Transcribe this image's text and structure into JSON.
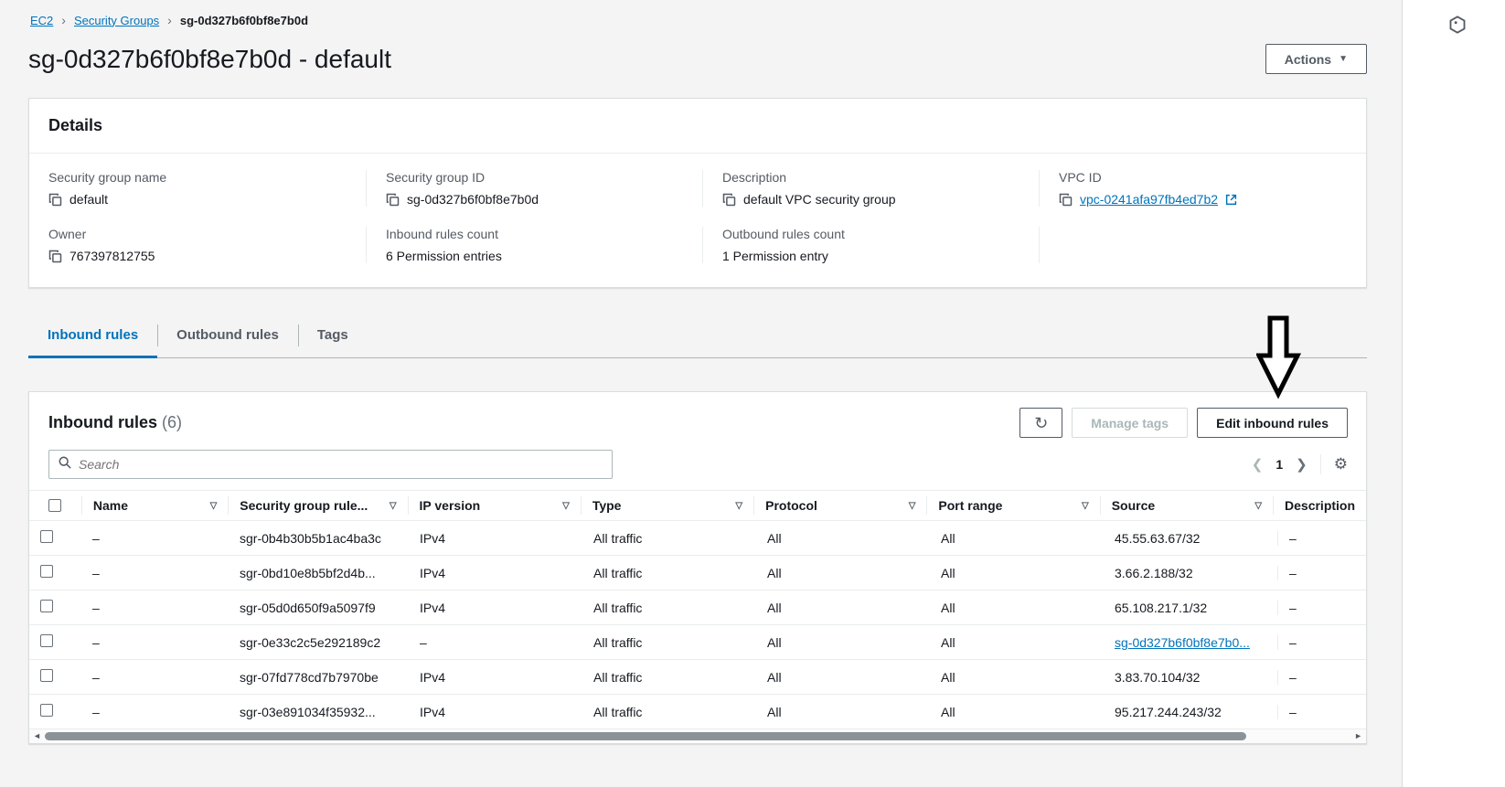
{
  "breadcrumb": {
    "sep": "›",
    "items": {
      "ec2": "EC2",
      "security_groups": "Security Groups",
      "current": "sg-0d327b6f0bf8e7b0d"
    }
  },
  "header": {
    "title": "sg-0d327b6f0bf8e7b0d - default",
    "actions_button": "Actions"
  },
  "details": {
    "title": "Details",
    "fields": {
      "sg_name": {
        "label": "Security group name",
        "value": "default"
      },
      "sg_id": {
        "label": "Security group ID",
        "value": "sg-0d327b6f0bf8e7b0d"
      },
      "desc": {
        "label": "Description",
        "value": "default VPC security group"
      },
      "vpc": {
        "label": "VPC ID",
        "value": "vpc-0241afa97fb4ed7b2"
      },
      "owner": {
        "label": "Owner",
        "value": "767397812755"
      },
      "inbound": {
        "label": "Inbound rules count",
        "value": "6 Permission entries"
      },
      "outbound": {
        "label": "Outbound rules count",
        "value": "1 Permission entry"
      }
    }
  },
  "tabs": {
    "inbound": "Inbound rules",
    "outbound": "Outbound rules",
    "tags": "Tags"
  },
  "rules": {
    "title": "Inbound rules",
    "count": "(6)",
    "manage_tags_button": "Manage tags",
    "edit_button": "Edit inbound rules",
    "search_placeholder": "Search",
    "pagination": {
      "page": "1"
    },
    "columns": {
      "name": "Name",
      "rule_id": "Security group rule...",
      "ip_version": "IP version",
      "type": "Type",
      "protocol": "Protocol",
      "port_range": "Port range",
      "source": "Source",
      "description": "Description"
    },
    "rows": [
      {
        "name": "–",
        "rule_id": "sgr-0b4b30b5b1ac4ba3c",
        "ip_version": "IPv4",
        "type": "All traffic",
        "protocol": "All",
        "port_range": "All",
        "source": "45.55.63.67/32",
        "source_link": false,
        "description": "–"
      },
      {
        "name": "–",
        "rule_id": "sgr-0bd10e8b5bf2d4b...",
        "ip_version": "IPv4",
        "type": "All traffic",
        "protocol": "All",
        "port_range": "All",
        "source": "3.66.2.188/32",
        "source_link": false,
        "description": "–"
      },
      {
        "name": "–",
        "rule_id": "sgr-05d0d650f9a5097f9",
        "ip_version": "IPv4",
        "type": "All traffic",
        "protocol": "All",
        "port_range": "All",
        "source": "65.108.217.1/32",
        "source_link": false,
        "description": "–"
      },
      {
        "name": "–",
        "rule_id": "sgr-0e33c2c5e292189c2",
        "ip_version": "–",
        "type": "All traffic",
        "protocol": "All",
        "port_range": "All",
        "source": "sg-0d327b6f0bf8e7b0...",
        "source_link": true,
        "description": "–"
      },
      {
        "name": "–",
        "rule_id": "sgr-07fd778cd7b7970be",
        "ip_version": "IPv4",
        "type": "All traffic",
        "protocol": "All",
        "port_range": "All",
        "source": "3.83.70.104/32",
        "source_link": false,
        "description": "–"
      },
      {
        "name": "–",
        "rule_id": "sgr-03e891034f35932...",
        "ip_version": "IPv4",
        "type": "All traffic",
        "protocol": "All",
        "port_range": "All",
        "source": "95.217.244.243/32",
        "source_link": false,
        "description": "–"
      }
    ]
  },
  "colors": {
    "link_blue": "#0073bb",
    "text_dark": "#16191f",
    "label_gray": "#545b64",
    "panel_bg": "#f4f4f4"
  }
}
